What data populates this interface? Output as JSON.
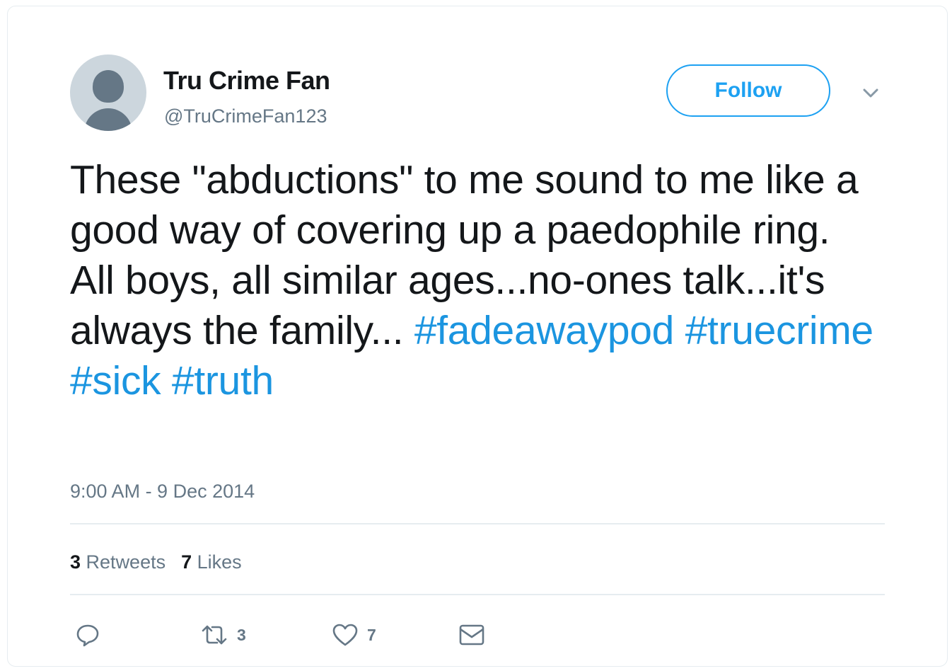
{
  "user": {
    "display_name": "Tru Crime Fan",
    "handle": "@TruCrimeFan123"
  },
  "follow_label": "Follow",
  "tweet": {
    "text": "These \"abductions\" to me sound to me like a good way of covering up a paedophile ring. All boys, all similar ages...no-ones talk...it's always the family...",
    "hashtags": [
      "#fadeawaypod",
      "#truecrime",
      "#sick",
      "#truth"
    ]
  },
  "timestamp": "9:00 AM - 9 Dec 2014",
  "stats": {
    "retweets_count": "3",
    "retweets_label": "Retweets",
    "likes_count": "7",
    "likes_label": "Likes"
  },
  "actions": {
    "retweet_count": "3",
    "like_count": "7"
  },
  "icons": {
    "caret": "chevron-down-icon",
    "reply": "reply-icon",
    "retweet": "retweet-icon",
    "like": "heart-icon",
    "message": "envelope-icon"
  },
  "colors": {
    "accent": "#1da1f2",
    "hashtag": "#1b95e0",
    "secondary_text": "#657786",
    "avatar_bg": "#ccd6dd"
  }
}
